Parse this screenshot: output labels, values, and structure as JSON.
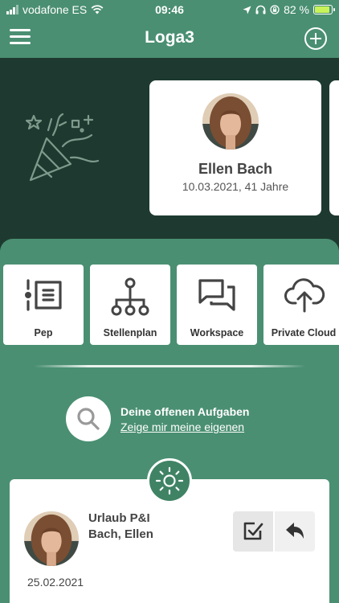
{
  "status": {
    "carrier": "vodafone ES",
    "time": "09:46",
    "battery": "82 %",
    "battery_level": 0.82
  },
  "header": {
    "title": "Loga3"
  },
  "birthday": {
    "name": "Ellen Bach",
    "details": "10.03.2021, 41 Jahre"
  },
  "tiles": [
    {
      "label": "Pep"
    },
    {
      "label": "Stellenplan"
    },
    {
      "label": "Workspace"
    },
    {
      "label": "Private Cloud"
    }
  ],
  "tasks": {
    "title": "Deine offenen Aufgaben",
    "link": "Zeige mir meine eigenen"
  },
  "request": {
    "type": "Urlaub P&I",
    "person": "Bach, Ellen",
    "date": "25.02.2021"
  },
  "colors": {
    "primary": "#4a8f72",
    "dark_band": "#1e3a30",
    "battery_fill": "#c8f25a"
  }
}
